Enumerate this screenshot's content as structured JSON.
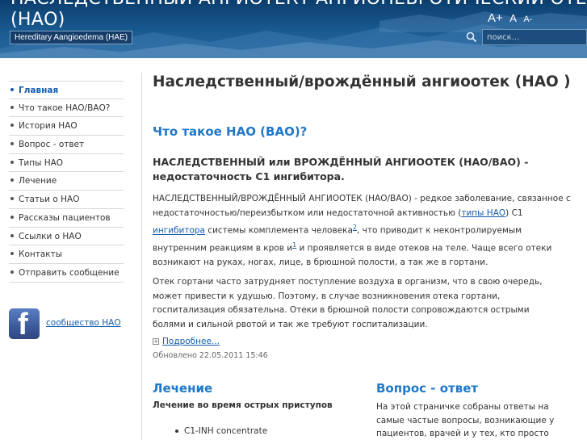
{
  "header": {
    "title_line1": "НАСЛЕДСТВЕННЫЙ АНГИОТЕКТ АНГИОНЕВРОТИЧЕСКИЙ ОТЕК",
    "title_line2": "(НАО)",
    "subtitle": "Hereditary Aangioedema (HAE)",
    "font_increase": "A+",
    "font_reset": "A",
    "font_decrease": "A-",
    "search_placeholder": "поиск..."
  },
  "sidebar": {
    "items": [
      {
        "label": "Главная",
        "active": true
      },
      {
        "label": "Что такое НАО/ВАО?"
      },
      {
        "label": "История НАО"
      },
      {
        "label": "Вопрос - ответ"
      },
      {
        "label": "Типы НАО"
      },
      {
        "label": "Лечение"
      },
      {
        "label": "Статьи о НАО"
      },
      {
        "label": "Рассказы пациентов"
      },
      {
        "label": "Ссылки о НАО"
      },
      {
        "label": "Контакты"
      },
      {
        "label": "Отправить сообщение"
      }
    ],
    "facebook_label": "сообщество НАО"
  },
  "main": {
    "page_title": "Наследственный/врождённый ангиоотек (НАО )",
    "section_title": "Что такое НАО (ВАО)?",
    "lead": "НАСЛЕДСТВЕННЫЙ или ВРОЖДЁННЫЙ АНГИООТЕК (НАО/ВАО) - недостаточность С1 ингибитора.",
    "para1": {
      "t1": "НАСЛЕДСТВЕННЫЙ/ВРОЖДЁННЫЙ АНГИООТЕК (НАО/ВАО) - редкое заболевание, связанное с недостаточностью/переизбытком или недостаточной активностью (",
      "link1": "типы НАО",
      "t2": ") С1 ",
      "link2": "ингибитора",
      "t3": " системы комплемента человека",
      "sup1": "2",
      "t4": ", что приводит к неконтролируемым внутренним реакциям в кров и",
      "sup2": "1",
      "t5": " и проявляется в виде отеков на теле. Чаще всего отеки возникают на руках, ногах, лице, в брюшной полости, а так же в гортани."
    },
    "para2": "Отек гортани часто затрудняет поступление воздуха в организм, что в свою очередь, может привести к удушью. Поэтому, в случае возникновения отека гортани, госпитализация обязательна. Отеки в брюшной полости сопровождаются острыми болями и сильной рвотой и так же требуют госпитализации.",
    "read_more": "Подробнее...",
    "updated": "Обновлено 22.05.2011 15:46"
  },
  "treatment": {
    "title": "Лечение",
    "subtitle": "Лечение во время острых приступов",
    "items": [
      "C1-INH concentrate"
    ]
  },
  "qa": {
    "title": "Вопрос - ответ",
    "text": "На этой страничке собраны ответы на самые частые вопросы, возникающие у пациентов, врачей и у тех, кто просто"
  },
  "colors": {
    "header_bg": "#1a5b92",
    "link": "#135cae",
    "heading_blue": "#1f77c7",
    "facebook": "#3b5998"
  }
}
